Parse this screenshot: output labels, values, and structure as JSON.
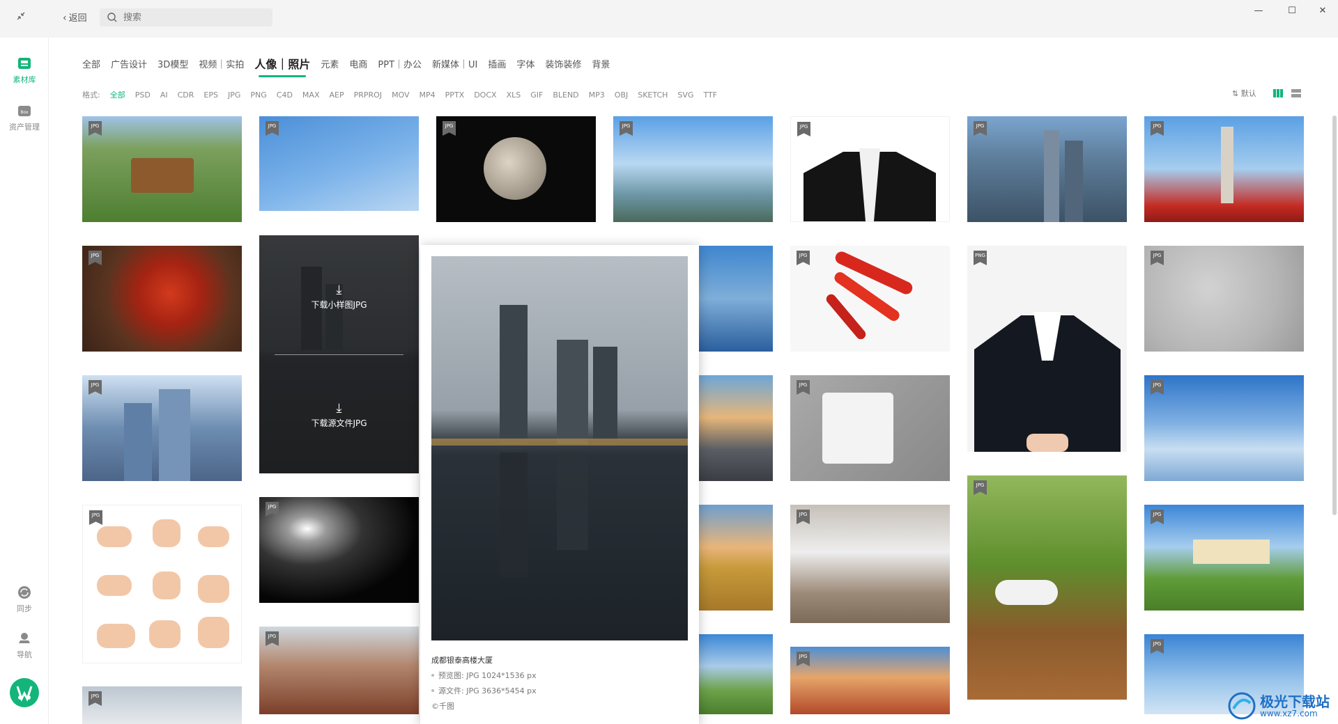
{
  "titlebar": {
    "back_label": "返回",
    "search_placeholder": "搜索"
  },
  "sidebar": {
    "items": [
      {
        "label": "素材库",
        "icon": "library-icon",
        "active": true
      },
      {
        "label": "资产管理",
        "icon": "box-icon",
        "active": false
      }
    ],
    "bottom_items": [
      {
        "label": "同步",
        "icon": "sync-icon"
      },
      {
        "label": "导航",
        "icon": "navigation-icon"
      }
    ],
    "box_icon_text": "Box"
  },
  "categories": [
    "全部",
    "广告设计",
    "3D模型",
    "视频｜实拍",
    "人像｜照片",
    "元素",
    "电商",
    "PPT｜办公",
    "新媒体｜UI",
    "插画",
    "字体",
    "装饰装修",
    "背景"
  ],
  "active_category": "人像｜照片",
  "formats": {
    "label": "格式:",
    "items": [
      "全部",
      "PSD",
      "AI",
      "CDR",
      "EPS",
      "JPG",
      "PNG",
      "C4D",
      "MAX",
      "AEP",
      "PRPROJ",
      "MOV",
      "MP4",
      "PPTX",
      "DOCX",
      "XLS",
      "GIF",
      "BLEND",
      "MP3",
      "OBJ",
      "SKETCH",
      "SVG",
      "TTF"
    ],
    "active": "全部"
  },
  "sort_label": "默认",
  "hover_card": {
    "download_preview": "下载小样图JPG",
    "download_source": "下载源文件JPG"
  },
  "popup": {
    "title": "成都银泰高楼大厦",
    "preview_label": "预览图: JPG 1024*1536 px",
    "source_label": "源文件: JPG 3636*5454 px",
    "copyright": "©千图"
  },
  "tags": {
    "jpg": "JPG",
    "png": "PNG"
  },
  "watermark": {
    "name": "极光下载站",
    "url": "www.xz7.com"
  },
  "colors": {
    "accent": "#13b57a"
  }
}
